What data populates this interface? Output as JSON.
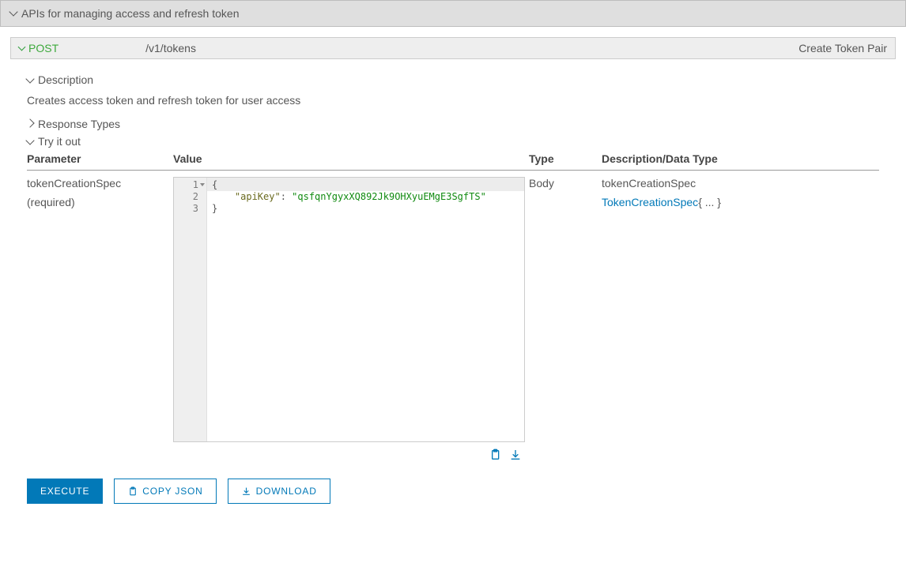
{
  "section": {
    "title": "APIs for managing access and refresh token"
  },
  "endpoint": {
    "method": "POST",
    "path": "/v1/tokens",
    "title": "Create Token Pair"
  },
  "description": {
    "heading": "Description",
    "text": "Creates access token and refresh token for user access"
  },
  "responseTypes": {
    "heading": "Response Types"
  },
  "tryItOut": {
    "heading": "Try it out"
  },
  "paramsTable": {
    "headers": {
      "parameter": "Parameter",
      "value": "Value",
      "type": "Type",
      "desc": "Description/Data Type"
    },
    "rows": [
      {
        "name": "tokenCreationSpec",
        "required": "(required)",
        "type": "Body",
        "descName": "tokenCreationSpec",
        "dataTypeLink": "TokenCreationSpec",
        "dataTypeSuffix": "{ ... }"
      }
    ]
  },
  "editor": {
    "lineNumbers": [
      "1",
      "2",
      "3"
    ],
    "code": {
      "brace_open": "{",
      "key": "\"apiKey\"",
      "colon": ": ",
      "value": "\"qsfqnYgyxXQ892Jk9OHXyuEMgE3SgfTS\"",
      "brace_close": "}"
    }
  },
  "buttons": {
    "execute": "EXECUTE",
    "copyJson": "COPY JSON",
    "download": "DOWNLOAD"
  }
}
